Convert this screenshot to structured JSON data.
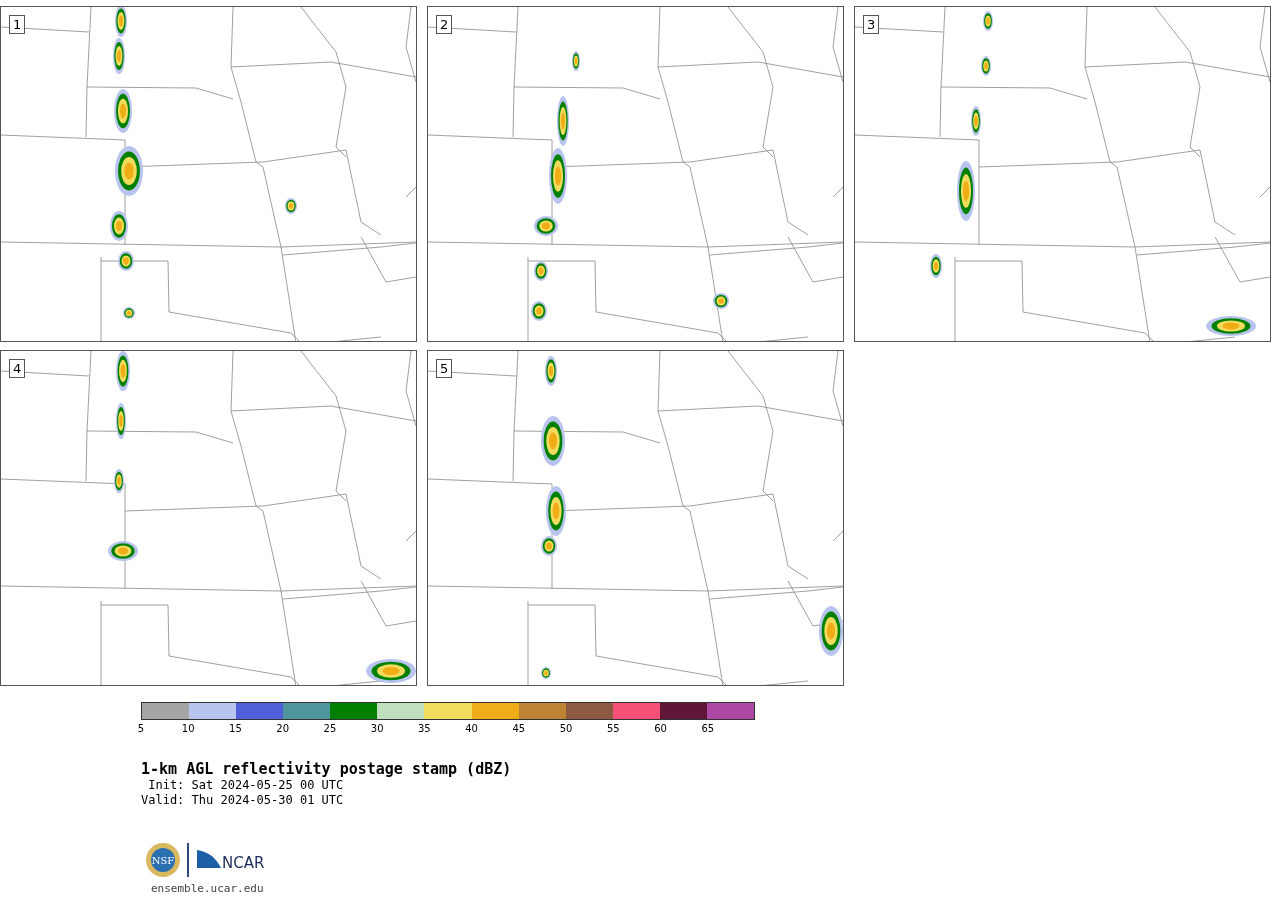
{
  "panels": [
    {
      "label": "1"
    },
    {
      "label": "2"
    },
    {
      "label": "3"
    },
    {
      "label": "4"
    },
    {
      "label": "5"
    }
  ],
  "colorbar": {
    "bins": [
      {
        "color": "#a5a5a5"
      },
      {
        "color": "#b8c4ee"
      },
      {
        "color": "#505ed8"
      },
      {
        "color": "#4f979c"
      },
      {
        "color": "#008000"
      },
      {
        "color": "#bfdfbf"
      },
      {
        "color": "#f1dc5d"
      },
      {
        "color": "#f1ad18"
      },
      {
        "color": "#bc8433"
      },
      {
        "color": "#8c5a40"
      },
      {
        "color": "#f55078"
      },
      {
        "color": "#601636"
      },
      {
        "color": "#ad49a5"
      }
    ],
    "ticks": [
      "5",
      "10",
      "15",
      "20",
      "25",
      "30",
      "35",
      "40",
      "45",
      "50",
      "55",
      "60",
      "65"
    ]
  },
  "title": "1-km AGL reflectivity postage stamp (dBZ)",
  "init": " Init: Sat 2024-05-25 00 UTC",
  "valid": "Valid: Thu 2024-05-30 01 UTC",
  "logos": {
    "nsf": "NSF",
    "ncar": "NCAR"
  },
  "website": "ensemble.ucar.edu"
}
